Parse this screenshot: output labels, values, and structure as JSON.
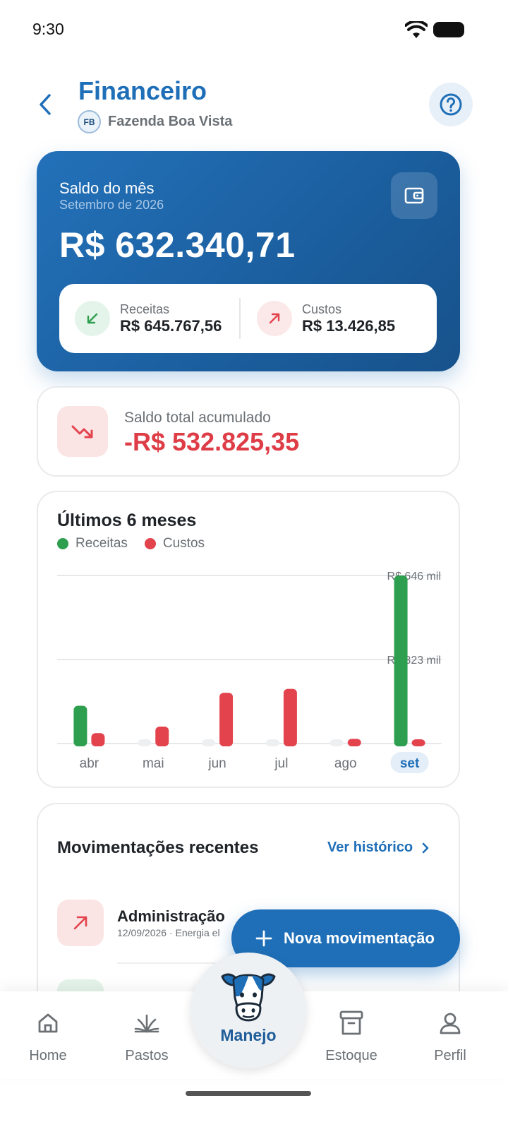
{
  "status_bar": {
    "time": "9:30"
  },
  "header": {
    "title": "Financeiro",
    "farm_initials": "FB",
    "farm_name": "Fazenda Boa Vista"
  },
  "balance_card": {
    "label": "Saldo do mês",
    "period": "Setembro de 2026",
    "amount": "R$ 632.340,71",
    "income_label": "Receitas",
    "income_value": "R$ 645.767,56",
    "cost_label": "Custos",
    "cost_value": "R$ 13.426,85"
  },
  "accumulated": {
    "label": "Saldo total acumulado",
    "amount": "-R$ 532.825,35"
  },
  "chart_section": {
    "title": "Últimos 6 meses",
    "legend_income": "Receitas",
    "legend_cost": "Custos"
  },
  "chart_data": {
    "type": "bar",
    "categories": [
      "abr",
      "mai",
      "jun",
      "jul",
      "ago",
      "set"
    ],
    "selected_category": "set",
    "series": [
      {
        "name": "Receitas",
        "color": "#2e9e4f",
        "values": [
          145000,
          0,
          0,
          0,
          0,
          645767.56
        ]
      },
      {
        "name": "Custos",
        "color": "#e3434d",
        "values": [
          40000,
          65000,
          195000,
          210000,
          18000,
          13426.85
        ]
      }
    ],
    "gridlines": [
      {
        "value": 645767.56,
        "label": "R$ 646 mil"
      },
      {
        "value": 323000,
        "label": "R$ 323 mil"
      }
    ],
    "ylim": [
      0,
      645767.56
    ]
  },
  "recent": {
    "title": "Movimentações recentes",
    "link": "Ver histórico",
    "items": [
      {
        "title": "Administração",
        "subtitle": "12/09/2026 · Energia el"
      }
    ]
  },
  "fab": {
    "label": "Nova movimentação"
  },
  "bottom_nav": {
    "home": "Home",
    "pastos": "Pastos",
    "manejo": "Manejo",
    "estoque": "Estoque",
    "perfil": "Perfil"
  },
  "colors": {
    "primary": "#1f6fb8",
    "income": "#2e9e4f",
    "cost": "#e3434d",
    "negative": "#de3c46"
  },
  "icons": [
    "back-icon",
    "help-icon",
    "wallet-icon",
    "arrow-down-left-icon",
    "arrow-up-right-icon",
    "trending-down-icon",
    "chevron-right-icon",
    "plus-icon",
    "home-icon",
    "pastos-icon",
    "cow-icon",
    "archive-icon",
    "user-icon"
  ]
}
